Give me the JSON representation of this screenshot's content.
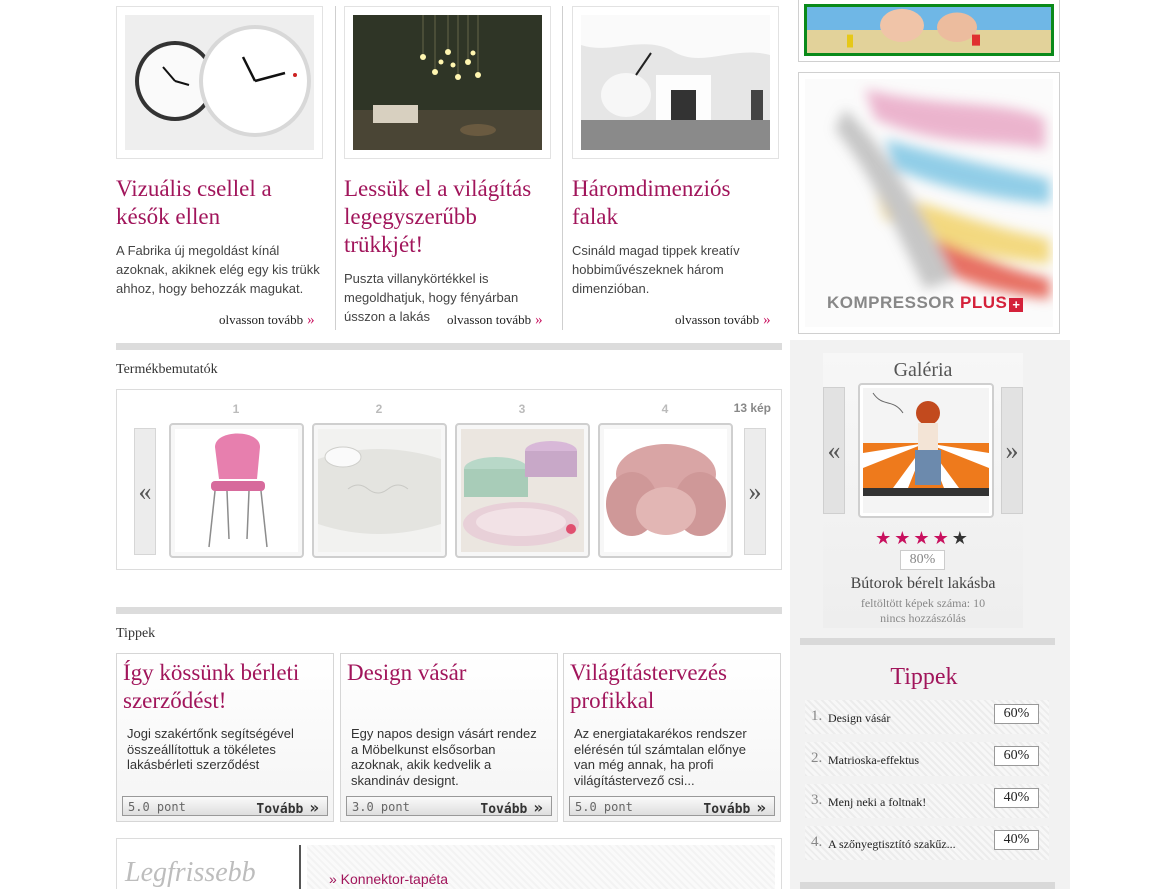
{
  "articles": [
    {
      "title": "Vizuális csellel a késők ellen",
      "text": "A Fabrika új megoldást kínál azoknak, akiknek elég egy kis trükk ahhoz, hogy behozzák magukat.",
      "more": "olvasson tovább",
      "image": "wall-clocks"
    },
    {
      "title": "Lessük el a világítás legegyszerűbb trükkjét!",
      "text": "Puszta villanykörtékkel is megoldhatjuk, hogy fényárban ússzon a lakás",
      "more": "olvasson tovább",
      "image": "light-bulbs-room"
    },
    {
      "title": "Háromdimenziós falak",
      "text": "Csináld magad tippek kreatív hobbiművészeknek három dimenzióban.",
      "more": "olvasson tovább",
      "image": "white-3d-wall-room"
    }
  ],
  "more_icon": "»",
  "products": {
    "label": "Termékbemutatók",
    "count": "13 kép",
    "prev": "«",
    "next": "»",
    "items": [
      {
        "num": "1",
        "image": "pink-shell-chair"
      },
      {
        "num": "2",
        "image": "white-ceramic-bowl"
      },
      {
        "num": "3",
        "image": "pastel-ceramic-bowls"
      },
      {
        "num": "4",
        "image": "pink-fur-armchair"
      }
    ]
  },
  "tips": {
    "label": "Tippek",
    "items": [
      {
        "title": "Így kössünk bérleti szerződést!",
        "text": "Jogi szakértőnk segítségével összeállítottuk a tökéletes lakásbérleti szerződést",
        "score": "5.0 pont",
        "go": "Tovább"
      },
      {
        "title": "Design vásár",
        "text": "Egy napos design vásárt rendez a Möbelkunst elsősorban azoknak, akik kedvelik a skandináv designt.",
        "score": "3.0 pont",
        "go": "Tovább"
      },
      {
        "title": "Világítástervezés profikkal",
        "text": "Az energiatakarékos rendszer elérésén túl számtalan előnye van még annak, ha profi világítástervező csi...",
        "score": "5.0 pont",
        "go": "Tovább"
      }
    ],
    "go_icon": "»"
  },
  "newest": {
    "title": "Legfrissebb",
    "links": [
      "» Konnektor-tapéta"
    ]
  },
  "ads": {
    "top": "beach-photo-banner",
    "big_brand": "KOMPRESSOR",
    "big_brand_suffix": "PLUS"
  },
  "gallery": {
    "title": "Galéria",
    "prev": "«",
    "next": "»",
    "image": "woman-on-orange-sofa",
    "rating_stars": 4,
    "rating_max": 5,
    "percent": "80%",
    "name": "Bútorok bérelt lakásba",
    "uploaded": "feltöltött képek száma: 10",
    "comments": "nincs hozzászólás"
  },
  "side_tips": {
    "title": "Tippek",
    "items": [
      {
        "n": "1.",
        "label": "Design vásár",
        "pct": "60%"
      },
      {
        "n": "2.",
        "label": "Matrioska-effektus",
        "pct": "60%"
      },
      {
        "n": "3.",
        "label": "Menj neki a foltnak!",
        "pct": "40%"
      },
      {
        "n": "4.",
        "label": "A szőnyegtisztító szakűz...",
        "pct": "40%"
      }
    ]
  },
  "colors": {
    "accent": "#a1155b",
    "arrow": "#c8105e"
  }
}
